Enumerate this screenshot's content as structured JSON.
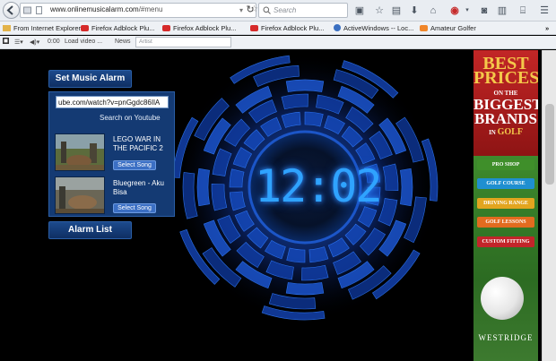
{
  "browser": {
    "url_host": "www.onlinemusicalarm.com",
    "url_path": "/#menu",
    "search_placeholder": "Search",
    "bookmarks": [
      {
        "label": "From Internet Explorer",
        "icon": "folder-icon",
        "color": "#e3b34a"
      },
      {
        "label": "Firefox Adblock Plu...",
        "icon": "youtube-icon",
        "color": "#d62a2a"
      },
      {
        "label": "Firefox Adblock Plu...",
        "icon": "youtube-icon",
        "color": "#d62a2a"
      },
      {
        "label": "Firefox Adblock Plu...",
        "icon": "youtube-icon",
        "color": "#d62a2a"
      },
      {
        "label": "ActiveWindows -- Loc...",
        "icon": "globe-icon",
        "color": "#3a6fc1"
      },
      {
        "label": "Amateur Golfer",
        "icon": "blogger-icon",
        "color": "#f0862a"
      }
    ],
    "more_label": "»",
    "addon": {
      "time": "0:00",
      "load_label": "Load video ...",
      "news_label": "News",
      "artist_placeholder": "Artist"
    }
  },
  "page": {
    "clock_time": "12:02",
    "set_music_label": "Set Music Alarm",
    "url_value": "ube.com/watch?v=pnGgdc86IlA",
    "search_youtube": "Search on Youtube",
    "songs": [
      {
        "title": "LEGO WAR IN THE PACIFIC 2",
        "button": "Select Song"
      },
      {
        "title": "Bluegreen - Aku Bisa",
        "button": "Select Song"
      }
    ],
    "alarm_list_label": "Alarm List"
  },
  "ad": {
    "line1": "BEST",
    "line2": "PRICES",
    "line3": "ON THE",
    "line4": "BIGGEST",
    "line5": "BRANDS",
    "line6_prefix": "IN",
    "line6_golf": "GOLF",
    "buttons": [
      {
        "label": "PRO SHOP",
        "color": "#3f8f2a"
      },
      {
        "label": "GOLF COURSE",
        "color": "#1f8fd0"
      },
      {
        "label": "DRIVING RANGE",
        "color": "#e2a51f"
      },
      {
        "label": "GOLF LESSONS",
        "color": "#e26b1f"
      },
      {
        "label": "CUSTOM FITTING",
        "color": "#c2252a"
      }
    ],
    "logo": "WESTRIDGE"
  },
  "colors": {
    "clock_blue": "#2fa3ff",
    "panel_blue": "#143a73"
  }
}
